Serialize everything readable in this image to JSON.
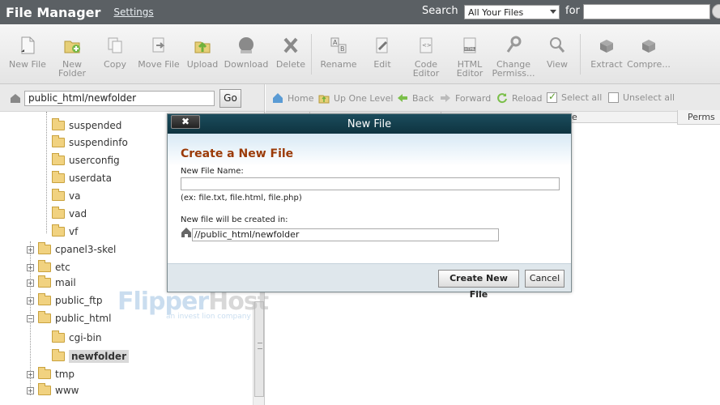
{
  "header": {
    "title": "File Manager",
    "settings_label": "Settings",
    "search_label": "Search",
    "search_scope": "All Your Files",
    "for_label": "for",
    "search_value": ""
  },
  "toolbar": {
    "new_file": "New File",
    "new_folder_1": "New",
    "new_folder_2": "Folder",
    "copy": "Copy",
    "move_file": "Move File",
    "upload": "Upload",
    "download": "Download",
    "delete": "Delete",
    "rename": "Rename",
    "edit": "Edit",
    "code_editor_1": "Code",
    "code_editor_2": "Editor",
    "html_editor_1": "HTML",
    "html_editor_2": "Editor",
    "change_perms_1": "Change",
    "change_perms_2": "Permiss...",
    "view": "View",
    "extract": "Extract",
    "compress": "Compre..."
  },
  "left": {
    "path_value": "public_html/newfolder",
    "go_label": "Go",
    "tree": [
      "suspended",
      "suspendinfo",
      "userconfig",
      "userdata",
      "va",
      "vad",
      "vf",
      "cpanel3-skel",
      "etc",
      "mail",
      "public_ftp",
      "public_html",
      "cgi-bin",
      "newfolder",
      "tmp",
      "www"
    ]
  },
  "watermark": {
    "brand_a": "Flipper",
    "brand_b": "Host",
    "tagline": "an invest lion company"
  },
  "right": {
    "home": "Home",
    "up_one_level": "Up One Level",
    "back": "Back",
    "forward": "Forward",
    "reload": "Reload",
    "select_all": "Select all",
    "unselect_all": "Unselect all",
    "col_partial": "e",
    "col_perms": "Perms"
  },
  "modal": {
    "close_label": "✖",
    "title": "New File",
    "heading": "Create a New File",
    "name_label": "New File Name:",
    "name_value": "",
    "example": "(ex: file.txt, file.html, file.php)",
    "location_label": "New file will be created in:",
    "location_value": "//public_html/newfolder",
    "create_label": "Create New File",
    "cancel_label": "Cancel"
  }
}
